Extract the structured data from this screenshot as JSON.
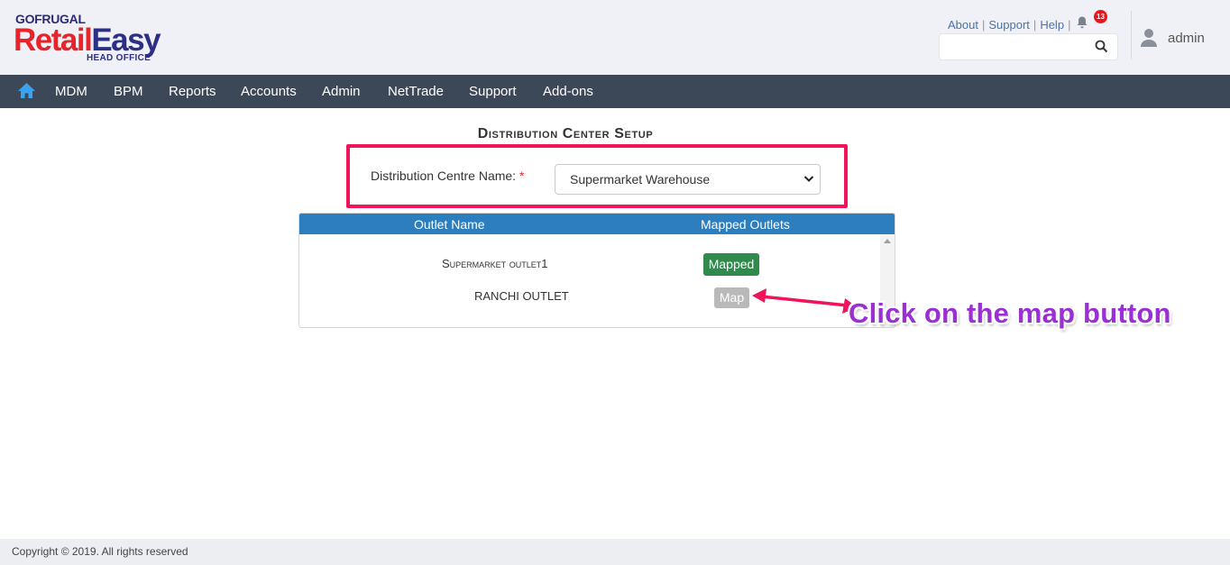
{
  "header": {
    "logo": {
      "gofrugal": "GOFRUGAL",
      "brand_retail": "Retail",
      "brand_easy": "Easy",
      "subtitle": "HEAD OFFICE"
    },
    "links": [
      "About",
      "Support",
      "Help"
    ],
    "notification_count": "13",
    "search": {
      "value": "",
      "placeholder": ""
    },
    "username": "admin"
  },
  "nav": {
    "items": [
      "MDM",
      "BPM",
      "Reports",
      "Accounts",
      "Admin",
      "NetTrade",
      "Support",
      "Add-ons"
    ]
  },
  "page": {
    "title": "Distribution Center Setup",
    "dc_label": "Distribution Centre Name:",
    "required_mark": "*",
    "dc_selected": "Supermarket Warehouse",
    "table": {
      "headers": [
        "Outlet Name",
        "Mapped Outlets"
      ],
      "rows": [
        {
          "name": "Supermarket outlet1",
          "action": "Mapped"
        },
        {
          "name": "RANCHI OUTLET",
          "action": "Map"
        }
      ]
    }
  },
  "annotation": {
    "text": "Click on the map button",
    "color": "#9a2fd3",
    "arrow_color": "#f0145a"
  },
  "footer": {
    "copyright": "Copyright © 2019. All rights reserved"
  },
  "colors": {
    "nav_bg": "#3c4858",
    "table_header": "#2d7ebf",
    "mapped_green": "#2f8a4c",
    "highlight_box": "#f0145a"
  }
}
